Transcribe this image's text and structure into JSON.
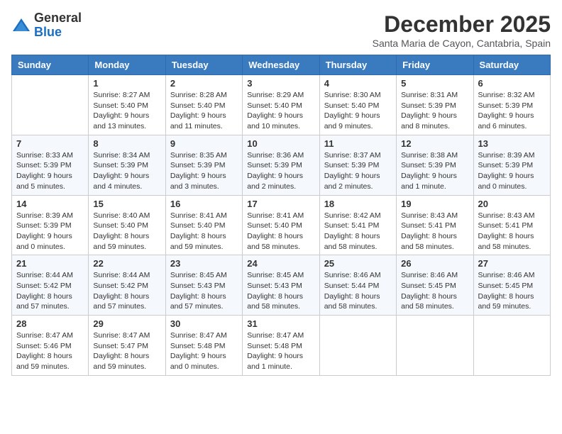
{
  "header": {
    "logo_line1": "General",
    "logo_line2": "Blue",
    "month": "December 2025",
    "location": "Santa Maria de Cayon, Cantabria, Spain"
  },
  "days_of_week": [
    "Sunday",
    "Monday",
    "Tuesday",
    "Wednesday",
    "Thursday",
    "Friday",
    "Saturday"
  ],
  "weeks": [
    [
      {
        "day": "",
        "info": ""
      },
      {
        "day": "1",
        "info": "Sunrise: 8:27 AM\nSunset: 5:40 PM\nDaylight: 9 hours\nand 13 minutes."
      },
      {
        "day": "2",
        "info": "Sunrise: 8:28 AM\nSunset: 5:40 PM\nDaylight: 9 hours\nand 11 minutes."
      },
      {
        "day": "3",
        "info": "Sunrise: 8:29 AM\nSunset: 5:40 PM\nDaylight: 9 hours\nand 10 minutes."
      },
      {
        "day": "4",
        "info": "Sunrise: 8:30 AM\nSunset: 5:40 PM\nDaylight: 9 hours\nand 9 minutes."
      },
      {
        "day": "5",
        "info": "Sunrise: 8:31 AM\nSunset: 5:39 PM\nDaylight: 9 hours\nand 8 minutes."
      },
      {
        "day": "6",
        "info": "Sunrise: 8:32 AM\nSunset: 5:39 PM\nDaylight: 9 hours\nand 6 minutes."
      }
    ],
    [
      {
        "day": "7",
        "info": "Sunrise: 8:33 AM\nSunset: 5:39 PM\nDaylight: 9 hours\nand 5 minutes."
      },
      {
        "day": "8",
        "info": "Sunrise: 8:34 AM\nSunset: 5:39 PM\nDaylight: 9 hours\nand 4 minutes."
      },
      {
        "day": "9",
        "info": "Sunrise: 8:35 AM\nSunset: 5:39 PM\nDaylight: 9 hours\nand 3 minutes."
      },
      {
        "day": "10",
        "info": "Sunrise: 8:36 AM\nSunset: 5:39 PM\nDaylight: 9 hours\nand 2 minutes."
      },
      {
        "day": "11",
        "info": "Sunrise: 8:37 AM\nSunset: 5:39 PM\nDaylight: 9 hours\nand 2 minutes."
      },
      {
        "day": "12",
        "info": "Sunrise: 8:38 AM\nSunset: 5:39 PM\nDaylight: 9 hours\nand 1 minute."
      },
      {
        "day": "13",
        "info": "Sunrise: 8:39 AM\nSunset: 5:39 PM\nDaylight: 9 hours\nand 0 minutes."
      }
    ],
    [
      {
        "day": "14",
        "info": "Sunrise: 8:39 AM\nSunset: 5:39 PM\nDaylight: 9 hours\nand 0 minutes."
      },
      {
        "day": "15",
        "info": "Sunrise: 8:40 AM\nSunset: 5:40 PM\nDaylight: 8 hours\nand 59 minutes."
      },
      {
        "day": "16",
        "info": "Sunrise: 8:41 AM\nSunset: 5:40 PM\nDaylight: 8 hours\nand 59 minutes."
      },
      {
        "day": "17",
        "info": "Sunrise: 8:41 AM\nSunset: 5:40 PM\nDaylight: 8 hours\nand 58 minutes."
      },
      {
        "day": "18",
        "info": "Sunrise: 8:42 AM\nSunset: 5:41 PM\nDaylight: 8 hours\nand 58 minutes."
      },
      {
        "day": "19",
        "info": "Sunrise: 8:43 AM\nSunset: 5:41 PM\nDaylight: 8 hours\nand 58 minutes."
      },
      {
        "day": "20",
        "info": "Sunrise: 8:43 AM\nSunset: 5:41 PM\nDaylight: 8 hours\nand 58 minutes."
      }
    ],
    [
      {
        "day": "21",
        "info": "Sunrise: 8:44 AM\nSunset: 5:42 PM\nDaylight: 8 hours\nand 57 minutes."
      },
      {
        "day": "22",
        "info": "Sunrise: 8:44 AM\nSunset: 5:42 PM\nDaylight: 8 hours\nand 57 minutes."
      },
      {
        "day": "23",
        "info": "Sunrise: 8:45 AM\nSunset: 5:43 PM\nDaylight: 8 hours\nand 57 minutes."
      },
      {
        "day": "24",
        "info": "Sunrise: 8:45 AM\nSunset: 5:43 PM\nDaylight: 8 hours\nand 58 minutes."
      },
      {
        "day": "25",
        "info": "Sunrise: 8:46 AM\nSunset: 5:44 PM\nDaylight: 8 hours\nand 58 minutes."
      },
      {
        "day": "26",
        "info": "Sunrise: 8:46 AM\nSunset: 5:45 PM\nDaylight: 8 hours\nand 58 minutes."
      },
      {
        "day": "27",
        "info": "Sunrise: 8:46 AM\nSunset: 5:45 PM\nDaylight: 8 hours\nand 59 minutes."
      }
    ],
    [
      {
        "day": "28",
        "info": "Sunrise: 8:47 AM\nSunset: 5:46 PM\nDaylight: 8 hours\nand 59 minutes."
      },
      {
        "day": "29",
        "info": "Sunrise: 8:47 AM\nSunset: 5:47 PM\nDaylight: 8 hours\nand 59 minutes."
      },
      {
        "day": "30",
        "info": "Sunrise: 8:47 AM\nSunset: 5:48 PM\nDaylight: 9 hours\nand 0 minutes."
      },
      {
        "day": "31",
        "info": "Sunrise: 8:47 AM\nSunset: 5:48 PM\nDaylight: 9 hours\nand 1 minute."
      },
      {
        "day": "",
        "info": ""
      },
      {
        "day": "",
        "info": ""
      },
      {
        "day": "",
        "info": ""
      }
    ]
  ]
}
